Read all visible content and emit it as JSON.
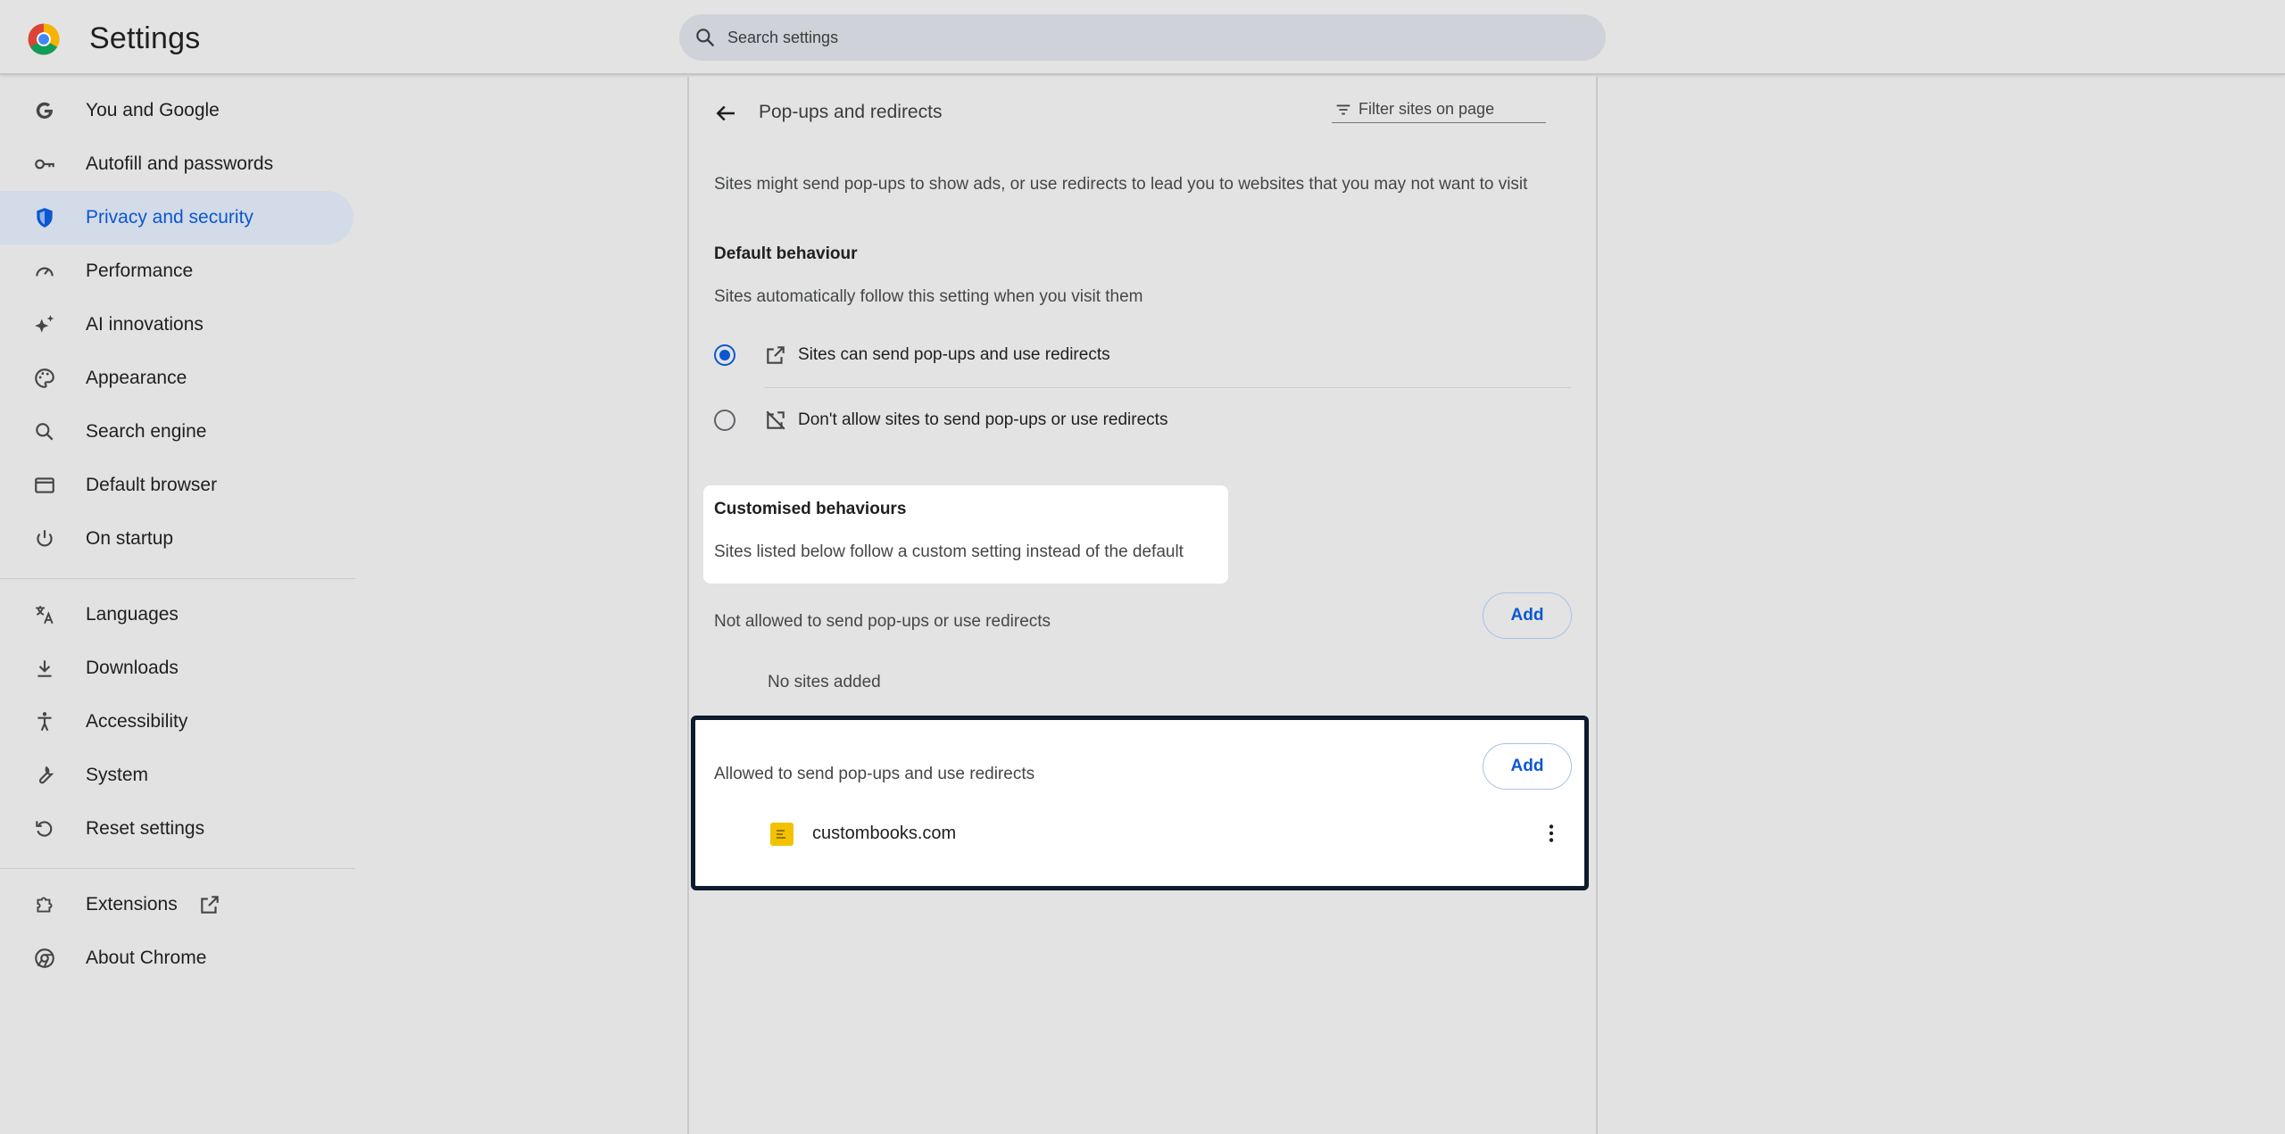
{
  "header": {
    "title": "Settings",
    "search_placeholder": "Search settings"
  },
  "sidebar": {
    "items": [
      {
        "label": "You and Google",
        "icon": "google-g-icon"
      },
      {
        "label": "Autofill and passwords",
        "icon": "key-icon"
      },
      {
        "label": "Privacy and security",
        "icon": "shield-icon",
        "active": true
      },
      {
        "label": "Performance",
        "icon": "speedometer-icon"
      },
      {
        "label": "AI innovations",
        "icon": "sparkle-icon"
      },
      {
        "label": "Appearance",
        "icon": "palette-icon"
      },
      {
        "label": "Search engine",
        "icon": "search-icon"
      },
      {
        "label": "Default browser",
        "icon": "browser-window-icon"
      },
      {
        "label": "On startup",
        "icon": "power-icon"
      },
      {
        "label": "Languages",
        "icon": "translate-icon"
      },
      {
        "label": "Downloads",
        "icon": "download-icon"
      },
      {
        "label": "Accessibility",
        "icon": "accessibility-icon"
      },
      {
        "label": "System",
        "icon": "wrench-icon"
      },
      {
        "label": "Reset settings",
        "icon": "reset-icon"
      },
      {
        "label": "Extensions",
        "icon": "puzzle-icon"
      },
      {
        "label": "About Chrome",
        "icon": "chrome-icon"
      }
    ]
  },
  "page": {
    "title": "Pop-ups and redirects",
    "filter_placeholder": "Filter sites on page",
    "description": "Sites might send pop-ups to show ads, or use redirects to lead you to websites that you may not want to visit",
    "default_heading": "Default behaviour",
    "default_sub": "Sites automatically follow this setting when you visit them",
    "options": [
      {
        "label": "Sites can send pop-ups and use redirects",
        "checked": true,
        "icon": "open-in-new-icon"
      },
      {
        "label": "Don't allow sites to send pop-ups or use redirects",
        "checked": false,
        "icon": "popup-blocked-icon"
      }
    ],
    "custom_heading": "Customised behaviours",
    "custom_sub": "Sites listed below follow a custom setting instead of the default",
    "blocked_heading": "Not allowed to send pop-ups or use redirects",
    "blocked_empty": "No sites added",
    "allowed_heading": "Allowed to send pop-ups and use redirects",
    "add_label": "Add",
    "allowed_sites": [
      {
        "name": "custombooks.com",
        "favicon_color": "#f2c200"
      }
    ]
  },
  "colors": {
    "accent": "#0b57d0",
    "active_nav_bg": "#d3dbe8",
    "focus_border": "#0e1b2e"
  }
}
